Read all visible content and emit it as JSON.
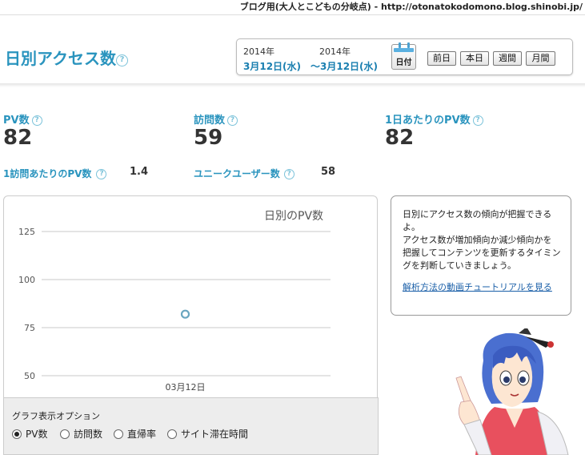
{
  "topbar": {
    "blog_name": "ブログ用(大人とこどもの分岐点)",
    "separator": " - ",
    "url": "http://otonatokodomono.blog.shinobi.jp/"
  },
  "page": {
    "title": "日別アクセス数",
    "help": "?"
  },
  "date_range": {
    "start_year": "2014年",
    "start_date": "3月12日(水)",
    "end_year": "2014年",
    "end_date": "〜3月12日(水)",
    "calendar_label": "日付",
    "buttons": [
      "前日",
      "本日",
      "週間",
      "月間"
    ]
  },
  "metrics": {
    "pv": {
      "label": "PV数",
      "value": "82"
    },
    "visits": {
      "label": "訪問数",
      "value": "59"
    },
    "pv_per_day": {
      "label": "1日あたりのPV数",
      "value": "82"
    },
    "pv_per_visit": {
      "label": "1訪問あたりのPV数",
      "value": "1.4"
    },
    "unique_users": {
      "label": "ユニークユーザー数",
      "value": "58"
    }
  },
  "chart_data": {
    "type": "line",
    "title": "日別のPV数",
    "categories": [
      "03月12日"
    ],
    "series": [
      {
        "values": [
          82
        ]
      }
    ],
    "y_ticks": [
      50,
      75,
      100,
      125
    ],
    "ylim": [
      50,
      125
    ],
    "marker_color": "#6aa6bf"
  },
  "graph_options": {
    "title": "グラフ表示オプション",
    "options": [
      "PV数",
      "訪問数",
      "直帰率",
      "サイト滞在時間"
    ],
    "selected": "PV数"
  },
  "help_bubble": {
    "lines": [
      "日別にアクセス数の傾向が把握できる",
      "よ。",
      "アクセス数が増加傾向か減少傾向かを",
      "把握してコンテンツを更新するタイミン",
      "グを判断していきましょう。"
    ],
    "link": "解析方法の動画チュートリアルを見る"
  },
  "colors": {
    "accent": "#2a94be",
    "link": "#1a5fa8"
  }
}
